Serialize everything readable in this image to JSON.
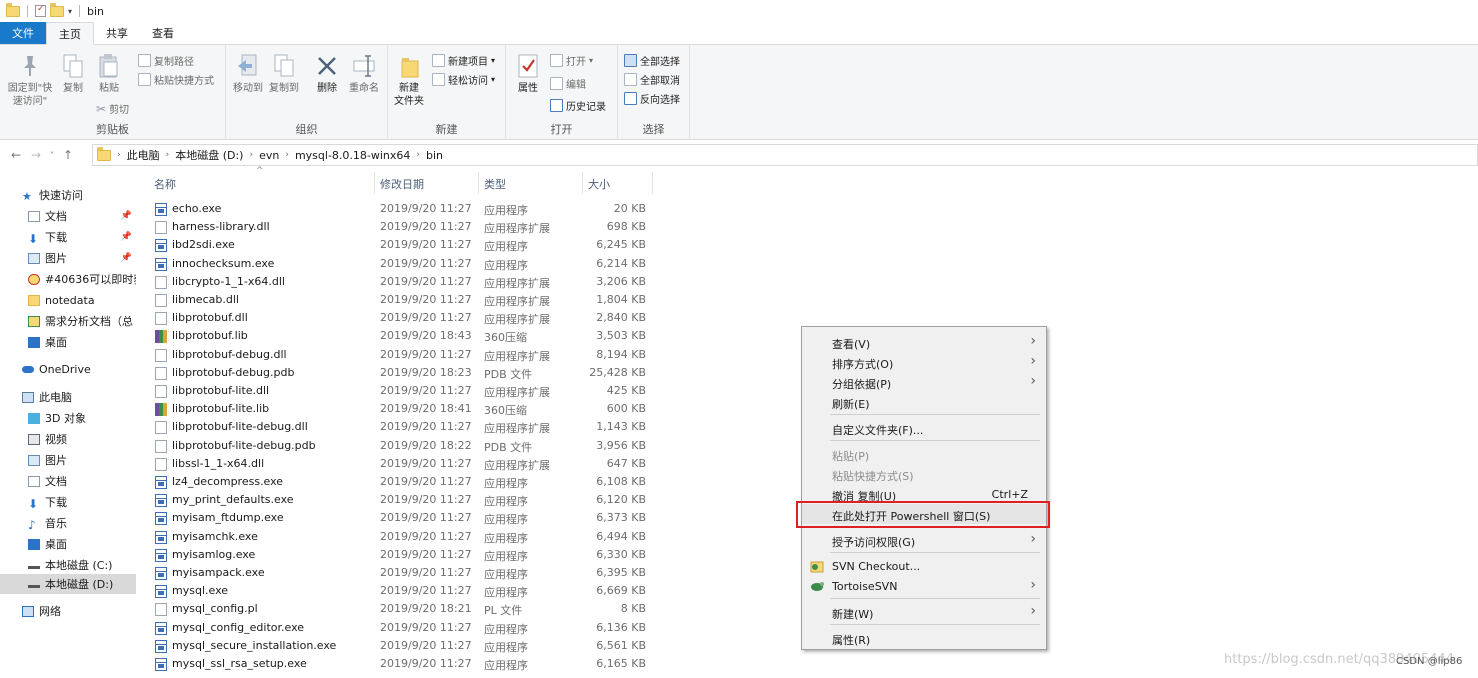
{
  "window": {
    "title": "bin"
  },
  "tabs": [
    "文件",
    "主页",
    "共享",
    "查看"
  ],
  "ribbon": {
    "clipboard": {
      "label": "剪贴板",
      "pin": "固定到\"快\n速访问\"",
      "copy": "复制",
      "paste": "粘贴",
      "copy_path": "复制路径",
      "paste_shortcut": "粘贴快捷方式",
      "cut": "剪切"
    },
    "organize": {
      "label": "组织",
      "move_to": "移动到",
      "copy_to": "复制到",
      "delete": "删除",
      "rename": "重命名"
    },
    "new": {
      "label": "新建",
      "new_folder": "新建\n文件夹",
      "new_item": "新建项目",
      "easy_access": "轻松访问"
    },
    "open": {
      "label": "打开",
      "properties": "属性",
      "open": "打开",
      "edit": "编辑",
      "history": "历史记录"
    },
    "select": {
      "label": "选择",
      "select_all": "全部选择",
      "select_none": "全部取消",
      "invert": "反向选择"
    }
  },
  "address": {
    "crumbs": [
      "此电脑",
      "本地磁盘 (D:)",
      "evn",
      "mysql-8.0.18-winx64",
      "bin"
    ]
  },
  "sidebar": {
    "items": [
      {
        "label": "快速访问"
      },
      {
        "label": "文档"
      },
      {
        "label": "下载"
      },
      {
        "label": "图片"
      },
      {
        "label": "#40636可以即时获"
      },
      {
        "label": "notedata"
      },
      {
        "label": "需求分析文档（总"
      },
      {
        "label": "桌面"
      },
      {
        "label": "OneDrive"
      },
      {
        "label": "此电脑"
      },
      {
        "label": "3D 对象"
      },
      {
        "label": "视频"
      },
      {
        "label": "图片"
      },
      {
        "label": "文档"
      },
      {
        "label": "下载"
      },
      {
        "label": "音乐"
      },
      {
        "label": "桌面"
      },
      {
        "label": "本地磁盘 (C:)"
      },
      {
        "label": "本地磁盘 (D:)"
      },
      {
        "label": "网络"
      }
    ]
  },
  "filelist": {
    "headers": {
      "name": "名称",
      "date": "修改日期",
      "type": "类型",
      "size": "大小"
    },
    "rows": [
      {
        "name": "echo.exe",
        "date": "2019/9/20 11:27",
        "type": "应用程序",
        "size": "20 KB",
        "kind": "exe"
      },
      {
        "name": "harness-library.dll",
        "date": "2019/9/20 11:27",
        "type": "应用程序扩展",
        "size": "698 KB",
        "kind": "dll"
      },
      {
        "name": "ibd2sdi.exe",
        "date": "2019/9/20 11:27",
        "type": "应用程序",
        "size": "6,245 KB",
        "kind": "exe"
      },
      {
        "name": "innochecksum.exe",
        "date": "2019/9/20 11:27",
        "type": "应用程序",
        "size": "6,214 KB",
        "kind": "exe"
      },
      {
        "name": "libcrypto-1_1-x64.dll",
        "date": "2019/9/20 11:27",
        "type": "应用程序扩展",
        "size": "3,206 KB",
        "kind": "dll"
      },
      {
        "name": "libmecab.dll",
        "date": "2019/9/20 11:27",
        "type": "应用程序扩展",
        "size": "1,804 KB",
        "kind": "dll"
      },
      {
        "name": "libprotobuf.dll",
        "date": "2019/9/20 11:27",
        "type": "应用程序扩展",
        "size": "2,840 KB",
        "kind": "dll"
      },
      {
        "name": "libprotobuf.lib",
        "date": "2019/9/20 18:43",
        "type": "360压缩",
        "size": "3,503 KB",
        "kind": "lib"
      },
      {
        "name": "libprotobuf-debug.dll",
        "date": "2019/9/20 11:27",
        "type": "应用程序扩展",
        "size": "8,194 KB",
        "kind": "dll"
      },
      {
        "name": "libprotobuf-debug.pdb",
        "date": "2019/9/20 18:23",
        "type": "PDB 文件",
        "size": "25,428 KB",
        "kind": "file"
      },
      {
        "name": "libprotobuf-lite.dll",
        "date": "2019/9/20 11:27",
        "type": "应用程序扩展",
        "size": "425 KB",
        "kind": "dll"
      },
      {
        "name": "libprotobuf-lite.lib",
        "date": "2019/9/20 18:41",
        "type": "360压缩",
        "size": "600 KB",
        "kind": "lib"
      },
      {
        "name": "libprotobuf-lite-debug.dll",
        "date": "2019/9/20 11:27",
        "type": "应用程序扩展",
        "size": "1,143 KB",
        "kind": "dll"
      },
      {
        "name": "libprotobuf-lite-debug.pdb",
        "date": "2019/9/20 18:22",
        "type": "PDB 文件",
        "size": "3,956 KB",
        "kind": "file"
      },
      {
        "name": "libssl-1_1-x64.dll",
        "date": "2019/9/20 11:27",
        "type": "应用程序扩展",
        "size": "647 KB",
        "kind": "dll"
      },
      {
        "name": "lz4_decompress.exe",
        "date": "2019/9/20 11:27",
        "type": "应用程序",
        "size": "6,108 KB",
        "kind": "exe"
      },
      {
        "name": "my_print_defaults.exe",
        "date": "2019/9/20 11:27",
        "type": "应用程序",
        "size": "6,120 KB",
        "kind": "exe"
      },
      {
        "name": "myisam_ftdump.exe",
        "date": "2019/9/20 11:27",
        "type": "应用程序",
        "size": "6,373 KB",
        "kind": "exe"
      },
      {
        "name": "myisamchk.exe",
        "date": "2019/9/20 11:27",
        "type": "应用程序",
        "size": "6,494 KB",
        "kind": "exe"
      },
      {
        "name": "myisamlog.exe",
        "date": "2019/9/20 11:27",
        "type": "应用程序",
        "size": "6,330 KB",
        "kind": "exe"
      },
      {
        "name": "myisampack.exe",
        "date": "2019/9/20 11:27",
        "type": "应用程序",
        "size": "6,395 KB",
        "kind": "exe"
      },
      {
        "name": "mysql.exe",
        "date": "2019/9/20 11:27",
        "type": "应用程序",
        "size": "6,669 KB",
        "kind": "exe"
      },
      {
        "name": "mysql_config.pl",
        "date": "2019/9/20 18:21",
        "type": "PL 文件",
        "size": "8 KB",
        "kind": "file"
      },
      {
        "name": "mysql_config_editor.exe",
        "date": "2019/9/20 11:27",
        "type": "应用程序",
        "size": "6,136 KB",
        "kind": "exe"
      },
      {
        "name": "mysql_secure_installation.exe",
        "date": "2019/9/20 11:27",
        "type": "应用程序",
        "size": "6,561 KB",
        "kind": "exe"
      },
      {
        "name": "mysql_ssl_rsa_setup.exe",
        "date": "2019/9/20 11:27",
        "type": "应用程序",
        "size": "6,165 KB",
        "kind": "exe"
      }
    ]
  },
  "context_menu": {
    "items": [
      {
        "label": "查看(V)",
        "submenu": true
      },
      {
        "label": "排序方式(O)",
        "submenu": true
      },
      {
        "label": "分组依据(P)",
        "submenu": true
      },
      {
        "label": "刷新(E)"
      },
      {
        "label": "自定义文件夹(F)..."
      },
      {
        "label": "粘贴(P)",
        "disabled": true
      },
      {
        "label": "粘贴快捷方式(S)",
        "disabled": true
      },
      {
        "label": "撤消 复制(U)",
        "shortcut": "Ctrl+Z"
      },
      {
        "label": "在此处打开 Powershell 窗口(S)",
        "highlighted": true
      },
      {
        "label": "授予访问权限(G)",
        "submenu": true
      },
      {
        "label": "SVN Checkout..."
      },
      {
        "label": "TortoiseSVN",
        "submenu": true
      },
      {
        "label": "新建(W)",
        "submenu": true
      },
      {
        "label": "属性(R)"
      }
    ]
  },
  "watermark": "https://blog.csdn.net/qq389405444",
  "csdn_tag": "CSDN @lip86",
  "colors": {
    "file_tab": "#1979ca",
    "highlight_box": "#e02020",
    "ribbon_bg": "#f5f6f7"
  }
}
